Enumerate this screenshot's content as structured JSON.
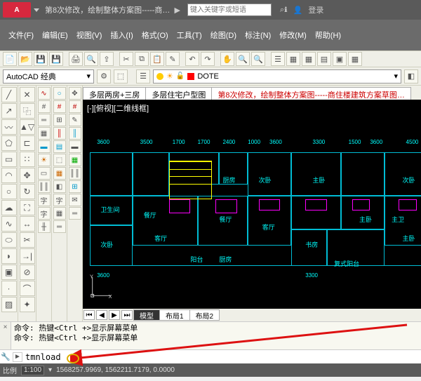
{
  "title": "第8次修改，绘制整体方案图-----商…",
  "search_placeholder": "键入关键字或短语",
  "login": "登录",
  "menu": [
    "文件(F)",
    "编辑(E)",
    "视图(V)",
    "插入(I)",
    "格式(O)",
    "工具(T)",
    "绘图(D)",
    "标注(N)",
    "修改(M)",
    "帮助(H)"
  ],
  "workspace": "AutoCAD 经典",
  "layer": "DOTE",
  "doc_tabs": [
    "多层两房+三房",
    "多层住宅户型图",
    "第8次修改，绘制整体方案图-----商住楼建筑方案草图…"
  ],
  "active_doc": 2,
  "viewport_label": "[-][俯视][二维线框]",
  "rooms": [
    "卫生间",
    "餐厅",
    "客厅",
    "厨房",
    "次卧",
    "阳台",
    "主卧",
    "书房",
    "主卫",
    "复式阳台"
  ],
  "dims": [
    "3600",
    "3500",
    "1700",
    "1700",
    "2400",
    "1000",
    "3600",
    "3300",
    "1500",
    "3600",
    "3600",
    "4500",
    "3300"
  ],
  "paper_tabs": [
    "模型",
    "布局1",
    "布局2"
  ],
  "cmd_history": [
    "命令: 热键<Ctrl +>显示屏幕菜单",
    "命令: 热键<Ctrl +>显示屏幕菜单"
  ],
  "cmd_input": "tmnload",
  "status": {
    "scale_label": "比例",
    "scale": "1:100",
    "coords": "1568257.9969, 1562211.7179, 0.0000"
  }
}
